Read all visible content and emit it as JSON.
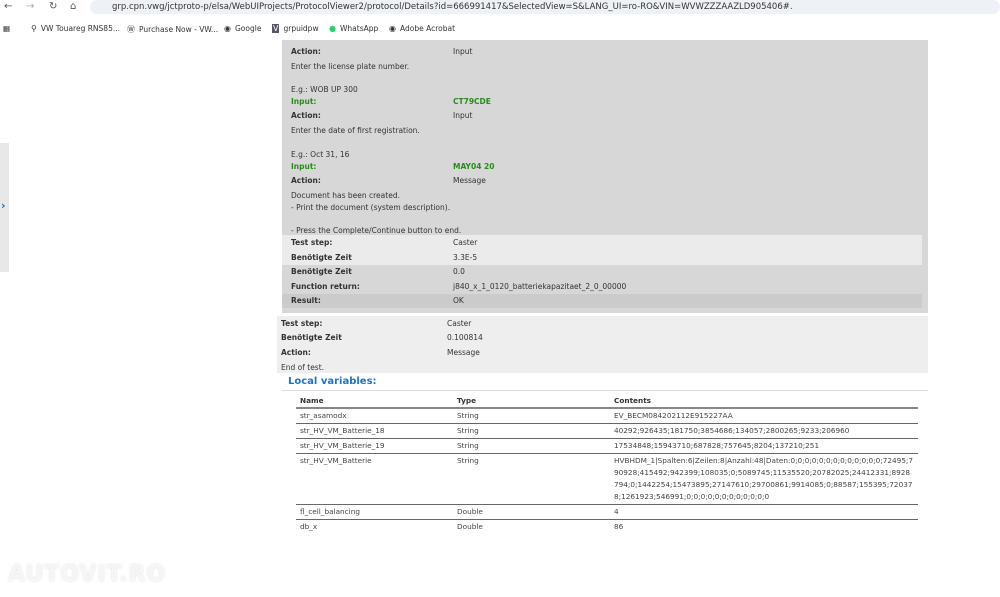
{
  "browser": {
    "url": "grp.cpn.vwg/jctproto-p/elsa/WebUIProjects/ProtocolViewer2/protocol/Details?id=666991417&SelectedView=S&LANG_UI=ro-RO&VIN=WVWZZZAAZLD905406#.",
    "bookmarks": [
      "VW Touareg RNS85...",
      "Purchase Now - VW...",
      "Google",
      "grpuidpw",
      "WhatsApp",
      "Adobe Acrobat"
    ]
  },
  "block1": {
    "action1_label": "Action:",
    "action1_value": "Input",
    "text1": "Enter the license plate number.",
    "eg1": "E.g.: WOB UP 300",
    "input1_label": "Input:",
    "input1_value": "CT79CDE",
    "action2_label": "Action:",
    "action2_value": "Input",
    "text2": "Enter the date of first registration.",
    "eg2": "E.g.: Oct 31, 16",
    "input2_label": "Input:",
    "input2_value": "MAY04 20",
    "action3_label": "Action:",
    "action3_value": "Message",
    "text3a": "Document has been created.",
    "text3b": "- Print the document (system description).",
    "text3c": "- Press the Complete/Continue button to end.",
    "teststep_label": "Test step:",
    "teststep_value": "Caster",
    "zeit1_label": "Benötigte Zeit",
    "zeit1_value": "3.3E-5",
    "zeit2_label": "Benötigte Zeit",
    "zeit2_value": "0.0",
    "func_label": "Function return:",
    "func_value": "j840_x_1_0120_batteriekapazitaet_2_0_00000",
    "result_label": "Result:",
    "result_value": "OK"
  },
  "block2": {
    "teststep_label": "Test step:",
    "teststep_value": "Caster",
    "zeit_label": "Benötigte Zeit",
    "zeit_value": "0.100814",
    "action_label": "Action:",
    "action_value": "Message",
    "text": "End of test."
  },
  "local_variables": {
    "heading": "Local variables:",
    "columns": [
      "Name",
      "Type",
      "Contents"
    ],
    "rows": [
      {
        "name": "str_asamodx",
        "type": "String",
        "contents": "EV_BECM084202112E915227AA"
      },
      {
        "name": "str_HV_VM_Batterie_18",
        "type": "String",
        "contents": "40292;926435;181750;3854686;134057;2800265;9233;206960"
      },
      {
        "name": "str_HV_VM_Batterie_19",
        "type": "String",
        "contents": "17534848;15943710;687828;757645;8204;137210;251"
      },
      {
        "name": "str_HV_VM_Batterie",
        "type": "String",
        "contents": "HVBHDM_1|Spalten:6|Zeilen:8|Anzahl:48|Daten:0;0;0;0;0;0;0;0;0;0;0;0;0;72495;790928;415492;942399;108035;0;5089745;11535520;20782025;24412331;8928794;0;1442254;15473895;27147610;29700861;9914085;0;88587;155395;720378;1261923;546991;0;0;0;0;0;0;0;0;0;0;0;0"
      },
      {
        "name": "fl_cell_balancing",
        "type": "Double",
        "contents": "4"
      },
      {
        "name": "db_x",
        "type": "Double",
        "contents": "86"
      }
    ]
  },
  "watermark": "AUTOVIT.RO"
}
